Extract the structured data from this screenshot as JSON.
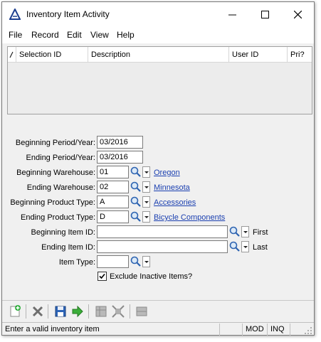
{
  "window": {
    "title": "Inventory Item Activity"
  },
  "menu": {
    "items": [
      "File",
      "Record",
      "Edit",
      "View",
      "Help"
    ]
  },
  "grid": {
    "columns": [
      {
        "label": "Selection ID"
      },
      {
        "label": "Description"
      },
      {
        "label": "User ID"
      },
      {
        "label": "Pri?"
      }
    ]
  },
  "form": {
    "beginning_period": {
      "label": "Beginning Period/Year:",
      "value": "03/2016"
    },
    "ending_period": {
      "label": "Ending Period/Year:",
      "value": "03/2016"
    },
    "beginning_warehouse": {
      "label": "Beginning Warehouse:",
      "value": "01",
      "desc": "Oregon"
    },
    "ending_warehouse": {
      "label": "Ending Warehouse:",
      "value": "02",
      "desc": "Minnesota"
    },
    "beginning_product_type": {
      "label": "Beginning Product Type:",
      "value": "A",
      "desc": "Accessories"
    },
    "ending_product_type": {
      "label": "Ending Product Type:",
      "value": "D",
      "desc": "Bicycle Components"
    },
    "beginning_item": {
      "label": "Beginning Item ID:",
      "value": "",
      "hint": "First"
    },
    "ending_item": {
      "label": "Ending Item ID:",
      "value": "",
      "hint": "Last"
    },
    "item_type": {
      "label": "Item Type:",
      "value": ""
    },
    "exclude_inactive": {
      "label": "Exclude Inactive Items?",
      "checked": true
    }
  },
  "toolbar": {
    "buttons": [
      "new-record-icon",
      "delete-icon",
      "save-icon",
      "go-arrow-icon",
      "grid-icon",
      "expand-icon",
      "list-icon"
    ]
  },
  "status": {
    "message": "Enter a valid inventory item",
    "mod": "MOD",
    "inq": "INQ"
  },
  "colors": {
    "link": "#1a3fb0",
    "window_bg": "#f0f0f0",
    "accent_logo": "#1d3f8f"
  }
}
